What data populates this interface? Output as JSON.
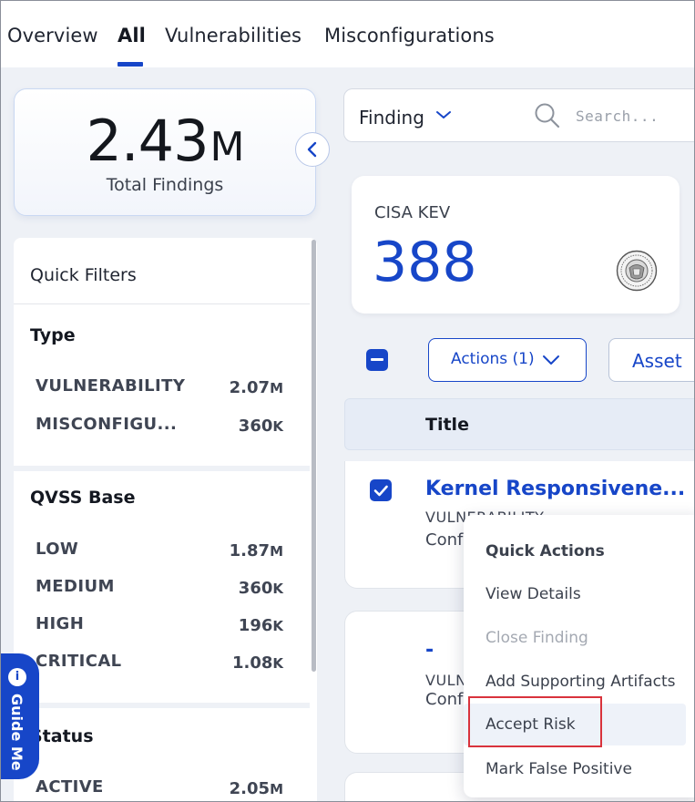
{
  "tabs": [
    {
      "label": "Overview"
    },
    {
      "label": "All"
    },
    {
      "label": "Vulnerabilities"
    },
    {
      "label": "Misconfigurations"
    }
  ],
  "active_tab": "All",
  "summary": {
    "total_value": "2.43",
    "total_unit": "M",
    "total_label": "Total Findings"
  },
  "quick_filters": {
    "title": "Quick Filters",
    "type": {
      "title": "Type",
      "items": [
        {
          "label": "VULNERABILITY",
          "value": "2.07",
          "unit": "M"
        },
        {
          "label": "MISCONFIGU...",
          "value": "360",
          "unit": "K"
        }
      ]
    },
    "qvss": {
      "title": "QVSS Base",
      "items": [
        {
          "label": "LOW",
          "value": "1.87",
          "unit": "M"
        },
        {
          "label": "MEDIUM",
          "value": "360",
          "unit": "K"
        },
        {
          "label": "HIGH",
          "value": "196",
          "unit": "K"
        },
        {
          "label": "CRITICAL",
          "value": "1.08",
          "unit": "K"
        }
      ]
    },
    "status": {
      "title": "Status",
      "items": [
        {
          "label": "ACTIVE",
          "value": "2.05",
          "unit": "M"
        }
      ]
    }
  },
  "guide_me": {
    "icon": "info-icon",
    "icon_glyph": "i",
    "label": "Guide Me"
  },
  "search": {
    "scope_label": "Finding",
    "placeholder": "Search..."
  },
  "kev_card": {
    "label": "CISA KEV",
    "value": "388",
    "seal_icon": "cisa-seal-icon"
  },
  "toolbar": {
    "actions_label": "Actions (1)",
    "asset_label": "Asset"
  },
  "table": {
    "column_title": "Title",
    "rows": [
      {
        "title": "Kernel Responsivene...",
        "type": "VULNERABILITY",
        "sub": "Conf"
      },
      {
        "title": "-",
        "type": "VULN",
        "sub": "Conf"
      }
    ]
  },
  "quick_actions": {
    "title": "Quick Actions",
    "items": [
      {
        "label": "View Details",
        "disabled": false
      },
      {
        "label": "Close Finding",
        "disabled": true
      },
      {
        "label": "Add Supporting Artifacts",
        "disabled": false
      },
      {
        "label": "Accept Risk",
        "disabled": false
      },
      {
        "label": "Mark False Positive",
        "disabled": false
      }
    ]
  },
  "colors": {
    "accent": "#1746c8",
    "highlight": "#d9333c",
    "background": "#eef1f6"
  }
}
